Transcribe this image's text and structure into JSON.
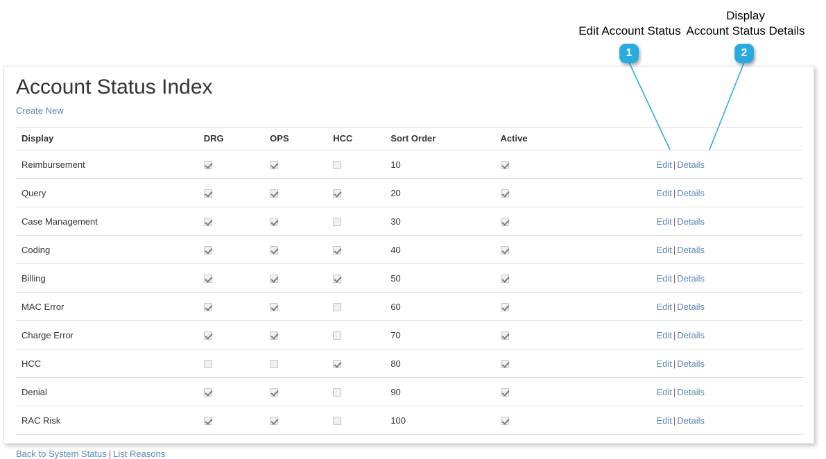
{
  "page": {
    "title": "Account Status Index",
    "create_new_label": "Create New"
  },
  "table": {
    "headers": {
      "display": "Display",
      "drg": "DRG",
      "ops": "OPS",
      "hcc": "HCC",
      "sort_order": "Sort Order",
      "active": "Active",
      "actions": ""
    },
    "action_labels": {
      "edit": "Edit",
      "details": "Details",
      "separator": "|"
    },
    "rows": [
      {
        "display": "Reimbursement",
        "drg": true,
        "ops": true,
        "hcc": false,
        "sort_order": "10",
        "active": true
      },
      {
        "display": "Query",
        "drg": true,
        "ops": true,
        "hcc": true,
        "sort_order": "20",
        "active": true
      },
      {
        "display": "Case Management",
        "drg": true,
        "ops": true,
        "hcc": false,
        "sort_order": "30",
        "active": true
      },
      {
        "display": "Coding",
        "drg": true,
        "ops": true,
        "hcc": true,
        "sort_order": "40",
        "active": true
      },
      {
        "display": "Billing",
        "drg": true,
        "ops": true,
        "hcc": true,
        "sort_order": "50",
        "active": true
      },
      {
        "display": "MAC Error",
        "drg": true,
        "ops": true,
        "hcc": false,
        "sort_order": "60",
        "active": true
      },
      {
        "display": "Charge Error",
        "drg": true,
        "ops": true,
        "hcc": false,
        "sort_order": "70",
        "active": true
      },
      {
        "display": "HCC",
        "drg": false,
        "ops": false,
        "hcc": true,
        "sort_order": "80",
        "active": true
      },
      {
        "display": "Denial",
        "drg": true,
        "ops": true,
        "hcc": false,
        "sort_order": "90",
        "active": true
      },
      {
        "display": "RAC Risk",
        "drg": true,
        "ops": true,
        "hcc": false,
        "sort_order": "100",
        "active": true
      }
    ]
  },
  "footer": {
    "back_label": "Back to System Status",
    "separator": "|",
    "list_reasons_label": "List Reasons"
  },
  "annotations": {
    "accent_color": "#29abe2",
    "items": [
      {
        "number": "1",
        "label": "Edit Account Status"
      },
      {
        "number": "2",
        "label": "Display\nAccount Status Details"
      }
    ]
  }
}
